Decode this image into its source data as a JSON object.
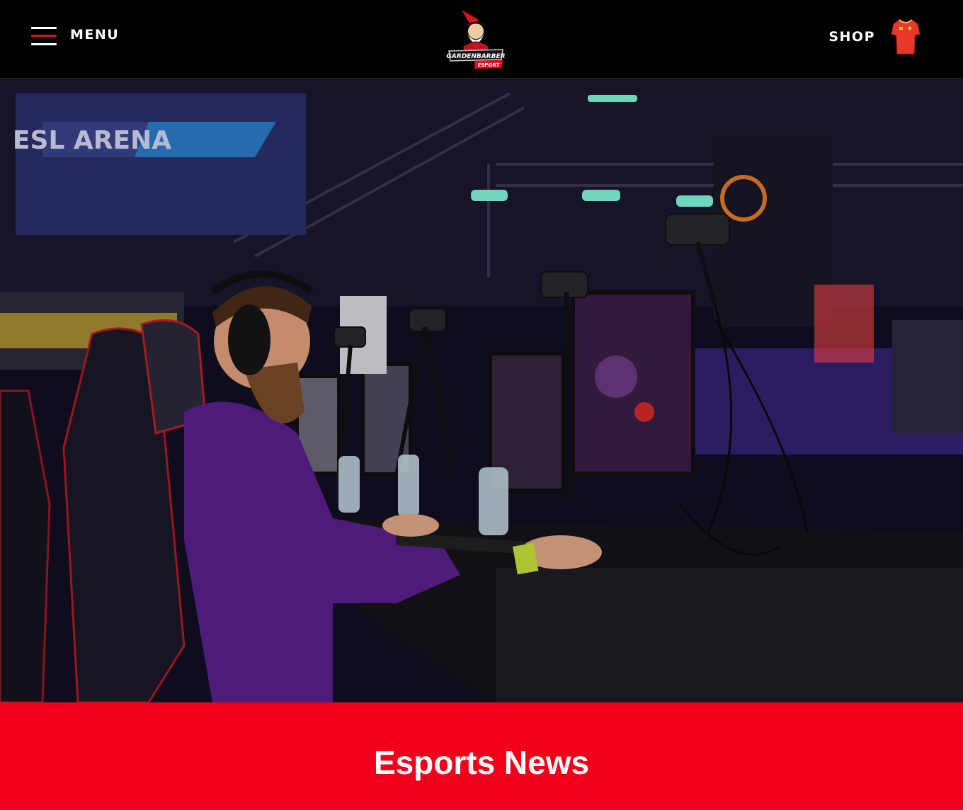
{
  "header": {
    "menu_label": "MENU",
    "menu_icon": "hamburger-icon",
    "logo": {
      "name": "GARDENBARBER",
      "sub": "ESPORT"
    },
    "shop_label": "SHOP",
    "shop_icon": "jersey-icon"
  },
  "hero": {
    "image_alt": "esports-player-at-tournament-photo",
    "banner_text": "ESL ARENA"
  },
  "news": {
    "title": "Esports News"
  },
  "colors": {
    "brand_red": "#f00019",
    "header_bg": "#000000",
    "text_light": "#ffffff",
    "jersey_red": "#e8382b"
  }
}
